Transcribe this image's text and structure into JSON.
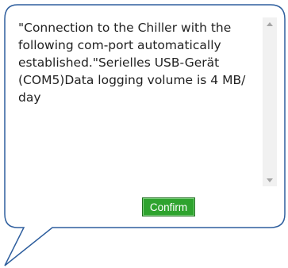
{
  "dialog": {
    "message": "\"Connection to the Chiller with the following com-port automatically established.\"Serielles USB-Gerät (COM5)Data logging volume is 4 MB/ day",
    "confirm_label": "Confirm"
  },
  "scrollbar": {
    "up_icon": "triangle-up-icon",
    "down_icon": "triangle-down-icon"
  },
  "colors": {
    "bubble_border": "#2f5f9e",
    "confirm_background": "#2ea32e",
    "confirm_border": "#1f6e1f",
    "scroll_track": "#f1f1f1",
    "scroll_arrow": "#a6a6a6"
  }
}
